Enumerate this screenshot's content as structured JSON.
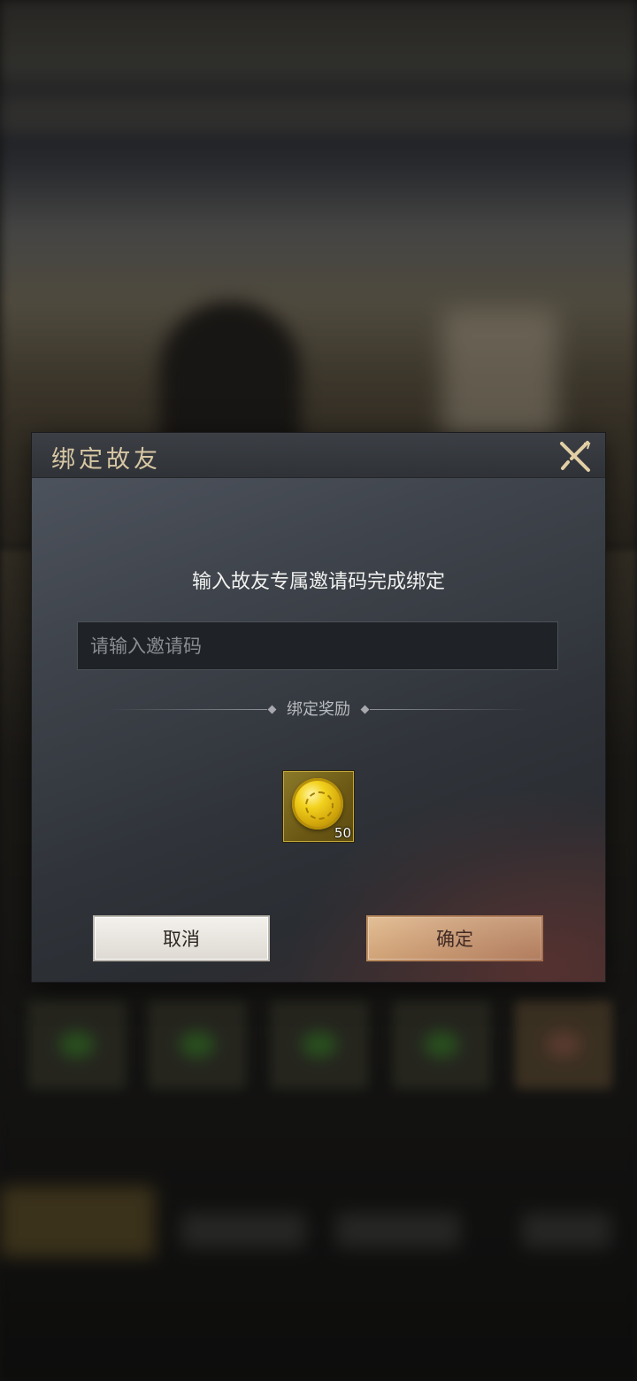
{
  "dialog": {
    "title": "绑定故友",
    "close_icon": "close-x-icon",
    "subtitle": "输入故友专属邀请码完成绑定",
    "input": {
      "value": "",
      "placeholder": "请输入邀请码"
    },
    "reward_section_label": "绑定奖励",
    "reward": {
      "icon": "gold-coin-icon",
      "count": "50"
    },
    "cancel_label": "取消",
    "confirm_label": "确定"
  },
  "colors": {
    "title_text": "#d8c7a4",
    "cancel_button": "#eae7e1",
    "confirm_button": "#e9c595"
  }
}
